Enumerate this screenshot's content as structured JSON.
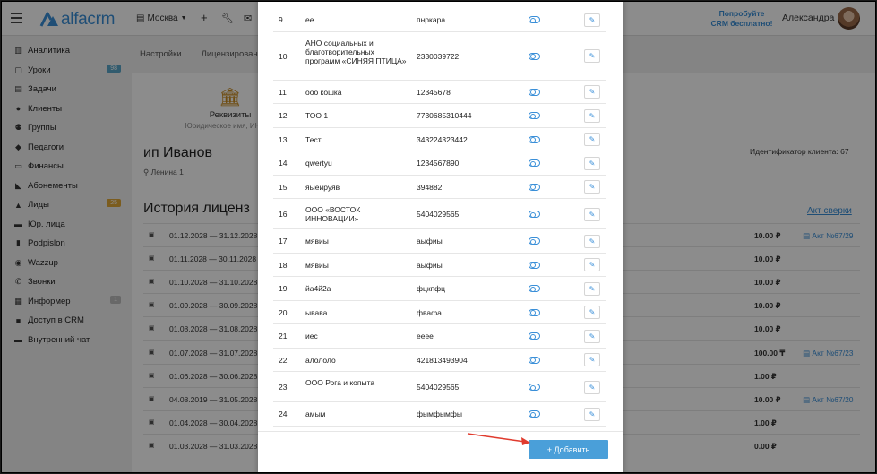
{
  "header": {
    "brand": "alfacrm",
    "city": "Москва",
    "promo_line1": "Попробуйте",
    "promo_line2": "CRM бесплатно!",
    "username": "Александра"
  },
  "sidebar": {
    "items": [
      {
        "label": "Аналитика",
        "icon": "chart-icon"
      },
      {
        "label": "Уроки",
        "icon": "calendar-icon",
        "badge": "98",
        "badge_color": "#5aa7c8"
      },
      {
        "label": "Задачи",
        "icon": "tasks-icon"
      },
      {
        "label": "Клиенты",
        "icon": "user-icon"
      },
      {
        "label": "Группы",
        "icon": "users-icon"
      },
      {
        "label": "Педагоги",
        "icon": "graduation-icon"
      },
      {
        "label": "Финансы",
        "icon": "money-icon"
      },
      {
        "label": "Абонементы",
        "icon": "tag-icon"
      },
      {
        "label": "Лиды",
        "icon": "lead-icon",
        "badge": "25",
        "badge_color": "#e0a838"
      },
      {
        "label": "Юр. лица",
        "icon": "briefcase-icon"
      },
      {
        "label": "Podpislon",
        "icon": "file-icon"
      },
      {
        "label": "Wazzup",
        "icon": "whatsapp-icon"
      },
      {
        "label": "Звонки",
        "icon": "phone-icon"
      },
      {
        "label": "Информер",
        "icon": "informer-icon",
        "badge": "1",
        "badge_color": "#bdbdbd"
      },
      {
        "label": "Доступ в CRM",
        "icon": "lock-icon"
      },
      {
        "label": "Внутренний чат",
        "icon": "chat-icon"
      }
    ]
  },
  "main": {
    "tabs": [
      "Настройки",
      "Лицензирован"
    ],
    "requisites_title": "Реквизиты",
    "requisites_sub": "Юридическое имя, ИНН, ...",
    "client_name": "ип Иванов",
    "client_address": "Ленина 1",
    "client_id": "Идентификатор клиента: 67",
    "history_title": "История лиценз",
    "act_link": "Акт сверки",
    "history": [
      {
        "period": "01.12.2028 — 31.12.2028",
        "amount": "10.00 ₽",
        "act": "Акт №67/29"
      },
      {
        "period": "01.11.2028 — 30.11.2028",
        "amount": "10.00 ₽",
        "act": ""
      },
      {
        "period": "01.10.2028 — 31.10.2028",
        "amount": "10.00 ₽",
        "act": ""
      },
      {
        "period": "01.09.2028 — 30.09.2028",
        "amount": "10.00 ₽",
        "act": ""
      },
      {
        "period": "01.08.2028 — 31.08.2028",
        "amount": "10.00 ₽",
        "act": ""
      },
      {
        "period": "01.07.2028 — 31.07.2028",
        "amount": "100.00 ₸",
        "act": "Акт №67/23"
      },
      {
        "period": "01.06.2028 — 30.06.2028",
        "amount": "1.00 ₽",
        "act": ""
      },
      {
        "period": "04.08.2019 — 31.05.2028",
        "amount": "10.00 ₽",
        "act": "Акт №67/20"
      },
      {
        "period": "01.04.2028 — 30.04.2028",
        "amount": "1.00 ₽",
        "act": ""
      },
      {
        "period": "01.03.2028 — 31.03.2028",
        "amount": "0.00 ₽",
        "act": ""
      }
    ]
  },
  "modal": {
    "rows": [
      {
        "num": "9",
        "name": "ее",
        "inn": "пнркара"
      },
      {
        "num": "10",
        "name": "АНО социальных и благотворительных программ «СИНЯЯ ПТИЦА»",
        "inn": "2330039722"
      },
      {
        "num": "11",
        "name": "ооо кошка",
        "inn": "12345678"
      },
      {
        "num": "12",
        "name": "ТОО 1",
        "inn": "7730685310444"
      },
      {
        "num": "13",
        "name": "Тест",
        "inn": "343224323442"
      },
      {
        "num": "14",
        "name": "qwertyu",
        "inn": "1234567890"
      },
      {
        "num": "15",
        "name": "яыеируяв",
        "inn": "394882"
      },
      {
        "num": "16",
        "name": "ООО «ВОСТОК ИННОВАЦИИ»",
        "inn": "5404029565"
      },
      {
        "num": "17",
        "name": "мявиы",
        "inn": "аыфиы"
      },
      {
        "num": "18",
        "name": "мявиы",
        "inn": "аыфиы"
      },
      {
        "num": "19",
        "name": "йа4й2а",
        "inn": "фцкпфц"
      },
      {
        "num": "20",
        "name": "ывава",
        "inn": "фвафа"
      },
      {
        "num": "21",
        "name": "иес",
        "inn": "ееее"
      },
      {
        "num": "22",
        "name": "алололо",
        "inn": "421813493904"
      },
      {
        "num": "23",
        "name": "ООО Рога и копыта",
        "inn": "5404029565"
      },
      {
        "num": "24",
        "name": "амым",
        "inn": "фымфымфы"
      }
    ],
    "add_button": "+ Добавить"
  },
  "colors": {
    "accent": "#3a8fd8",
    "button": "#4a9fd9",
    "arrow": "#e03b2e"
  }
}
